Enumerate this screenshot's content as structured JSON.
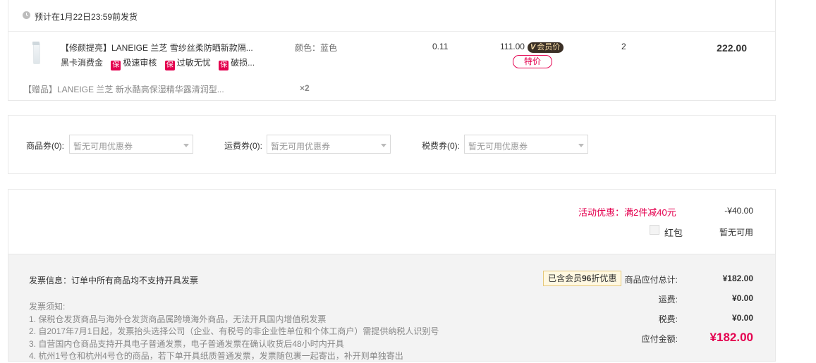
{
  "shipping": {
    "notice": "预计在1月22日23:59前发货"
  },
  "product": {
    "title": "【修颜提亮】LANEIGE 兰芝 雪纱丝柔防晒新款隔...",
    "badges": {
      "first": "黑卡消费金",
      "bao": "保",
      "b1": "极速审核",
      "b2": "过敏无忧",
      "b3": "破损..."
    },
    "attr": "颜色：蓝色",
    "tax": "0.11",
    "price": "111.00",
    "vip_tag_v": "V",
    "vip_tag": "会员价",
    "special": "特价",
    "qty": "2",
    "subtotal": "222.00"
  },
  "gift": {
    "title": "【赠品】LANEIGE 兰芝 新水酷高保湿精华露清润型...",
    "qty": "×2"
  },
  "coupons": {
    "goods_label": "商品券(0):",
    "goods_value": "暂无可用优惠券",
    "freight_label": "运费券(0):",
    "freight_value": "暂无可用优惠券",
    "tax_label": "税费券(0):",
    "tax_value": "暂无可用优惠券"
  },
  "summary": {
    "promo": "活动优惠：满2件减40元",
    "promo_amount": "-¥40.00",
    "hongbao_label": "红包",
    "hongbao_value": "暂无可用",
    "invoice_info": "发票信息：订单中所有商品均不支持开具发票",
    "notes": [
      "发票须知:",
      "1. 保税仓发货商品与海外仓发货商品属跨境海外商品，无法开具国内增值税发票",
      "2. 自2017年7月1日起，发票抬头选择公司（企业、有税号的非企业性单位和个体工商户）需提供纳税人识别号",
      "3. 自营国内仓商品支持开具电子普通发票，电子普通发票在确认收货后48小时内开具",
      "4. 杭州1号仓和杭州4号仓的商品，若下单开具纸质普通发票，发票随包裹一起寄出，补开则单独寄出"
    ],
    "vip_note_pre": "已含会员",
    "vip_note_bold": "96",
    "vip_note_post": "折优惠",
    "goods_total_label": "商品应付总计:",
    "goods_total": "¥182.00",
    "freight_label": "运费:",
    "freight": "¥0.00",
    "tax_label": "税费:",
    "tax": "¥0.00",
    "payable_label": "应付金额:",
    "payable": "¥182.00"
  }
}
